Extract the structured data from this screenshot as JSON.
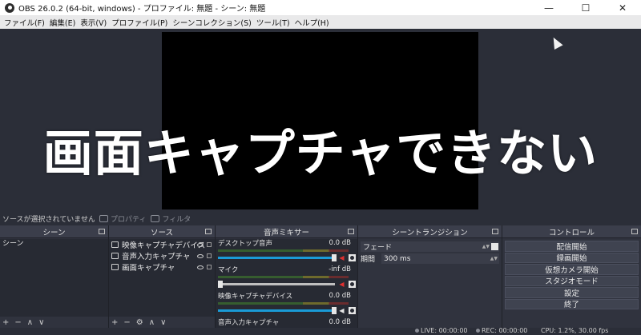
{
  "window": {
    "title": "OBS 26.0.2 (64-bit, windows) - プロファイル: 無題 - シーン: 無題",
    "app_icon": "obs-logo-icon",
    "minimize_glyph": "—",
    "maximize_glyph": "☐",
    "close_glyph": "✕"
  },
  "menu": [
    "ファイル(F)",
    "編集(E)",
    "表示(V)",
    "プロファイル(P)",
    "シーンコレクション(S)",
    "ツール(T)",
    "ヘルプ(H)"
  ],
  "overlay_text": "画面キャプチャできない",
  "propbar": {
    "selection_text": "ソースが選択されていません",
    "properties_label": "プロパティ",
    "filters_label": "フィルタ"
  },
  "docks": {
    "scenes": {
      "title": "シーン",
      "items": [
        "シーン"
      ],
      "toolbar": [
        "+",
        "−",
        "∧",
        "∨"
      ]
    },
    "sources": {
      "title": "ソース",
      "items": [
        {
          "label": "映像キャプチャデバイス",
          "icon": "camera-icon"
        },
        {
          "label": "音声入力キャプチャ",
          "icon": "microphone-icon"
        },
        {
          "label": "画面キャプチャ",
          "icon": "monitor-icon"
        }
      ],
      "toolbar": [
        "+",
        "−",
        "⚙",
        "∧",
        "∨"
      ]
    },
    "mixer": {
      "title": "音声ミキサー",
      "tracks": [
        {
          "name": "デスクトップ音声",
          "db": "0.0 dB",
          "muted": true
        },
        {
          "name": "マイク",
          "db": "-inf dB",
          "muted": true
        },
        {
          "name": "映像キャプチャデバイス",
          "db": "0.0 dB",
          "muted": false
        },
        {
          "name": "音声入力キャプチャ",
          "db": "0.0 dB",
          "muted": false
        }
      ]
    },
    "transitions": {
      "title": "シーントランジション",
      "selected": "フェード",
      "duration_label": "期間",
      "duration_value": "300 ms"
    },
    "controls": {
      "title": "コントロール",
      "buttons": [
        "配信開始",
        "録画開始",
        "仮想カメラ開始",
        "スタジオモード",
        "設定",
        "終了"
      ]
    }
  },
  "status": {
    "live": "LIVE: 00:00:00",
    "rec": "REC: 00:00:00",
    "cpu": "CPU: 1.2%, 30.00 fps"
  }
}
